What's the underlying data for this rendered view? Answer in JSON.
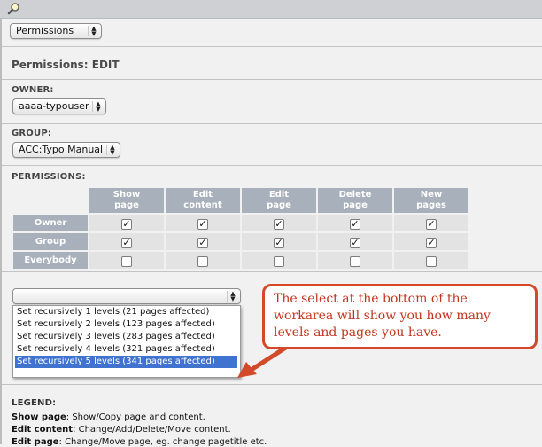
{
  "toolbar": {
    "search_icon": "magnifier-icon"
  },
  "header_select": {
    "value": "Permissions"
  },
  "page": {
    "title": "Permissions: EDIT"
  },
  "owner": {
    "label": "OWNER:",
    "value": "aaaa-typouser"
  },
  "group": {
    "label": "GROUP:",
    "value": "ACC:Typo Manual"
  },
  "permissions": {
    "label": "PERMISSIONS:",
    "columns": [
      {
        "line1": "Show",
        "line2": "page"
      },
      {
        "line1": "Edit",
        "line2": "content"
      },
      {
        "line1": "Edit",
        "line2": "page"
      },
      {
        "line1": "Delete",
        "line2": "page"
      },
      {
        "line1": "New",
        "line2": "pages"
      }
    ],
    "rows": [
      {
        "label": "Owner",
        "checks": [
          true,
          true,
          true,
          true,
          true
        ]
      },
      {
        "label": "Group",
        "checks": [
          true,
          true,
          true,
          true,
          true
        ]
      },
      {
        "label": "Everybody",
        "checks": [
          false,
          false,
          false,
          false,
          false
        ]
      }
    ]
  },
  "recursive": {
    "value": "",
    "options": [
      "Set recursively 1 levels (21 pages affected)",
      "Set recursively 2 levels (123 pages affected)",
      "Set recursively 3 levels (283 pages affected)",
      "Set recursively 4 levels (321 pages affected)",
      "Set recursively 5 levels (341 pages affected)"
    ],
    "selected_index": 4
  },
  "callout": {
    "text": "The select at the bottom of the workarea will show you how many levels and pages you have.",
    "color": "#d34a2a"
  },
  "legend": {
    "label": "LEGEND:",
    "items": [
      {
        "term": "Show page",
        "desc": ": Show/Copy page and content."
      },
      {
        "term": "Edit content",
        "desc": ": Change/Add/Delete/Move content."
      },
      {
        "term": "Edit page",
        "desc": ": Change/Move page, eg. change pagetitle etc."
      }
    ]
  }
}
